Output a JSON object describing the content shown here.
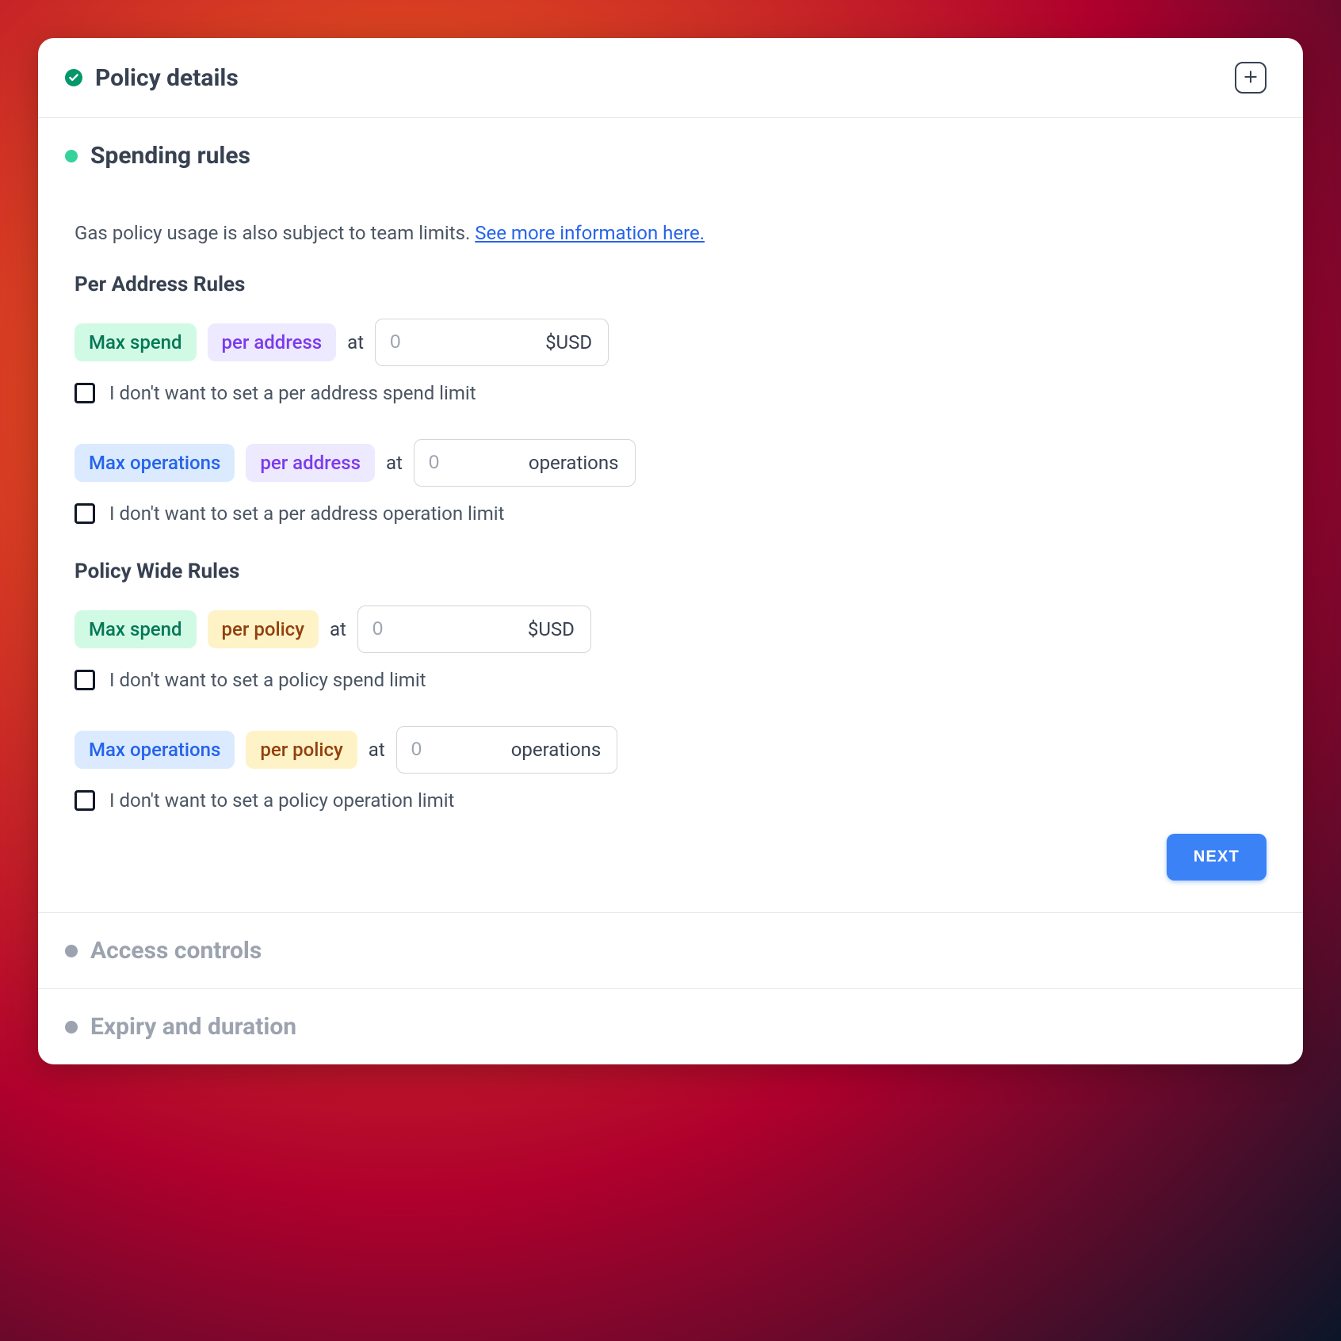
{
  "sections": {
    "policy_details": {
      "title": "Policy details"
    },
    "spending_rules": {
      "title": "Spending rules",
      "intro_prefix": "Gas policy usage is also subject to team limits. ",
      "intro_link": "See more information here.",
      "per_address_heading": "Per Address Rules",
      "policy_wide_heading": "Policy Wide Rules"
    },
    "access_controls": {
      "title": "Access controls"
    },
    "expiry": {
      "title": "Expiry and duration"
    }
  },
  "chips": {
    "max_spend": "Max spend",
    "per_address": "per address",
    "max_operations": "Max operations",
    "per_policy": "per policy"
  },
  "labels": {
    "at": "at",
    "usd": "$USD",
    "operations": "operations",
    "next": "NEXT"
  },
  "inputs": {
    "placeholder_zero": "0",
    "per_address_spend": "",
    "per_address_ops": "",
    "policy_spend": "",
    "policy_ops": ""
  },
  "checks": {
    "no_per_address_spend": "I don't want to set a per address spend limit",
    "no_per_address_ops": "I don't want to set a per address operation limit",
    "no_policy_spend": "I don't want to set a policy spend limit",
    "no_policy_ops": "I don't want to set a policy operation limit"
  }
}
